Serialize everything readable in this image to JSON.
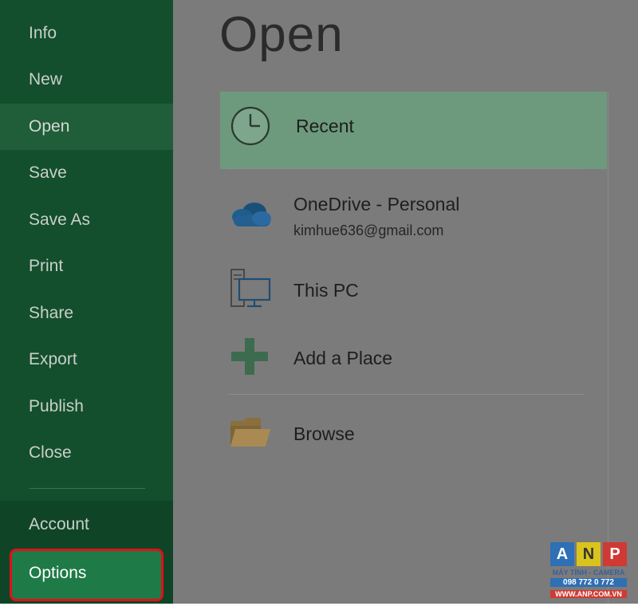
{
  "sidebar": {
    "items": [
      {
        "label": "Info"
      },
      {
        "label": "New"
      },
      {
        "label": "Open"
      },
      {
        "label": "Save"
      },
      {
        "label": "Save As"
      },
      {
        "label": "Print"
      },
      {
        "label": "Share"
      },
      {
        "label": "Export"
      },
      {
        "label": "Publish"
      },
      {
        "label": "Close"
      }
    ],
    "account_label": "Account",
    "options_label": "Options",
    "active_item": "Open"
  },
  "main": {
    "title": "Open",
    "places": {
      "recent": "Recent",
      "onedrive_label": "OneDrive - Personal",
      "onedrive_email": "kimhue636@gmail.com",
      "this_pc": "This PC",
      "add_place": "Add a Place",
      "browse": "Browse"
    }
  },
  "watermark": {
    "letters": [
      "A",
      "N",
      "P"
    ],
    "tagline": "MÁY TÍNH - CAMERA",
    "phone": "098 772 0 772",
    "url": "WWW.ANP.COM.VN"
  },
  "colors": {
    "sidebar": "#134f2c",
    "options_highlight": "#1e7a46",
    "options_border": "#e0101a",
    "recent_highlight": "#6d9a7c",
    "dim_overlay": "#7b7b7b"
  }
}
